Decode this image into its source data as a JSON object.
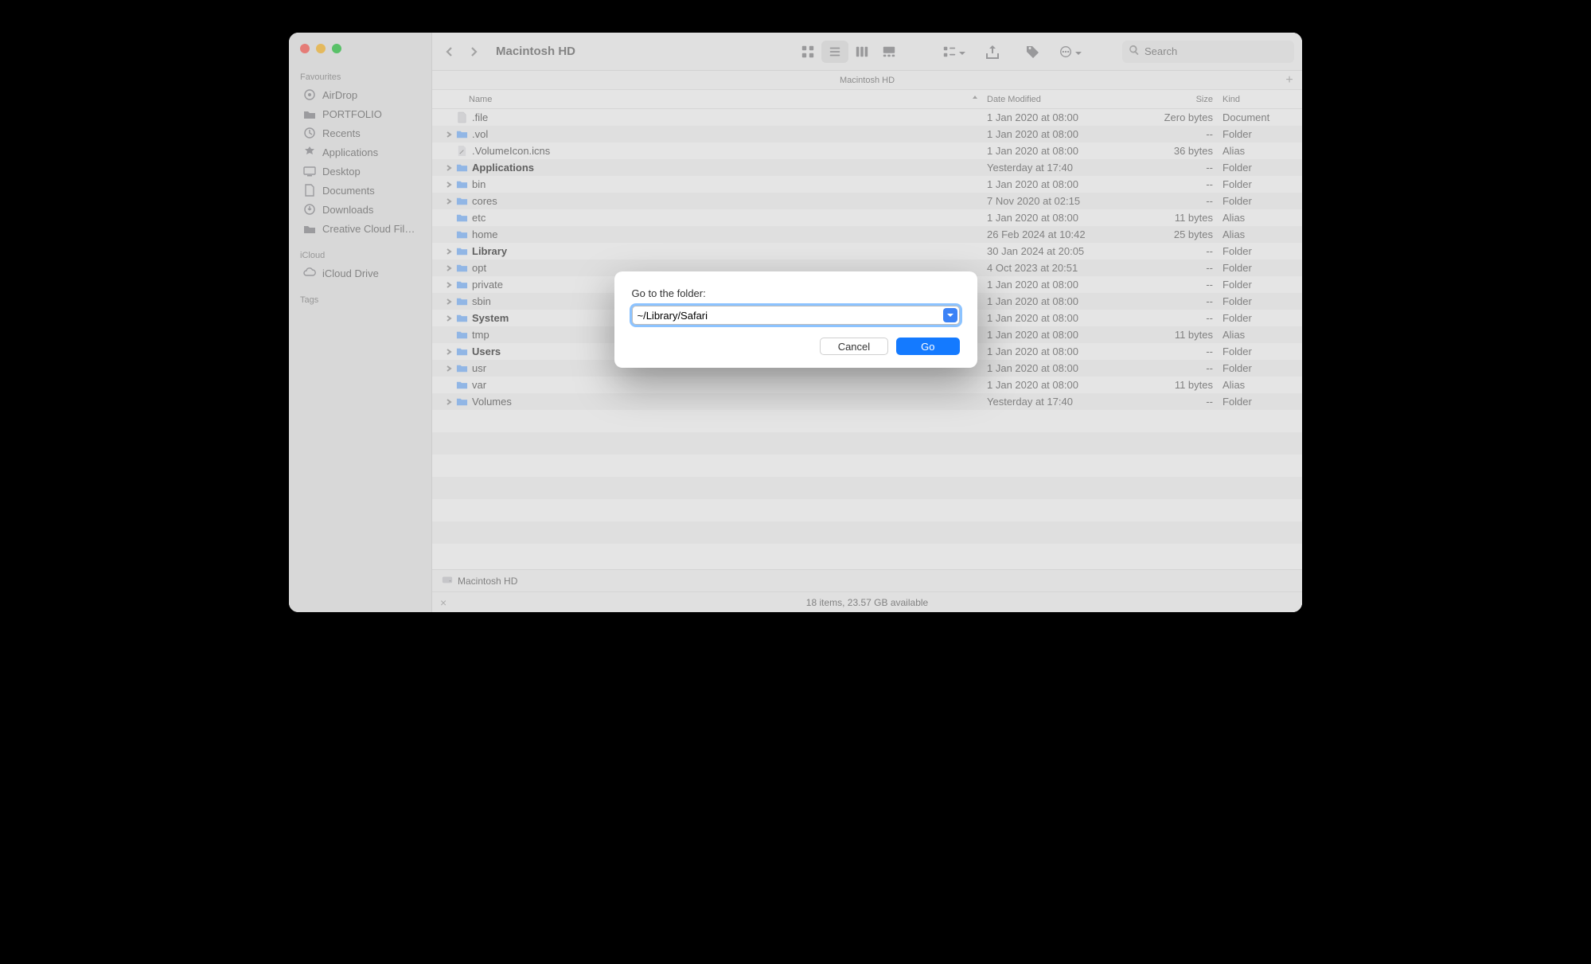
{
  "window_title": "Macintosh HD",
  "subtitle": "Macintosh HD",
  "search_placeholder": "Search",
  "sidebar": {
    "favourites_label": "Favourites",
    "items": [
      {
        "label": "AirDrop"
      },
      {
        "label": "PORTFOLIO"
      },
      {
        "label": "Recents"
      },
      {
        "label": "Applications"
      },
      {
        "label": "Desktop"
      },
      {
        "label": "Documents"
      },
      {
        "label": "Downloads"
      },
      {
        "label": "Creative Cloud Fil…"
      }
    ],
    "icloud_label": "iCloud",
    "icloud_items": [
      {
        "label": "iCloud Drive"
      }
    ],
    "tags_label": "Tags"
  },
  "columns": {
    "name": "Name",
    "date": "Date Modified",
    "size": "Size",
    "kind": "Kind"
  },
  "files": [
    {
      "name": ".file",
      "date": "1 Jan 2020 at 08:00",
      "size": "Zero bytes",
      "kind": "Document",
      "icon": "doc",
      "expand": false,
      "bold": false
    },
    {
      "name": ".vol",
      "date": "1 Jan 2020 at 08:00",
      "size": "--",
      "kind": "Folder",
      "icon": "folder",
      "expand": true,
      "bold": false
    },
    {
      "name": ".VolumeIcon.icns",
      "date": "1 Jan 2020 at 08:00",
      "size": "36 bytes",
      "kind": "Alias",
      "icon": "alias",
      "expand": false,
      "bold": false
    },
    {
      "name": "Applications",
      "date": "Yesterday at 17:40",
      "size": "--",
      "kind": "Folder",
      "icon": "folder",
      "expand": true,
      "bold": true
    },
    {
      "name": "bin",
      "date": "1 Jan 2020 at 08:00",
      "size": "--",
      "kind": "Folder",
      "icon": "folder",
      "expand": true,
      "bold": false
    },
    {
      "name": "cores",
      "date": "7 Nov 2020 at 02:15",
      "size": "--",
      "kind": "Folder",
      "icon": "folder",
      "expand": true,
      "bold": false
    },
    {
      "name": "etc",
      "date": "1 Jan 2020 at 08:00",
      "size": "11 bytes",
      "kind": "Alias",
      "icon": "folder",
      "expand": false,
      "bold": false
    },
    {
      "name": "home",
      "date": "26 Feb 2024 at 10:42",
      "size": "25 bytes",
      "kind": "Alias",
      "icon": "folder",
      "expand": false,
      "bold": false
    },
    {
      "name": "Library",
      "date": "30 Jan 2024 at 20:05",
      "size": "--",
      "kind": "Folder",
      "icon": "folder",
      "expand": true,
      "bold": true
    },
    {
      "name": "opt",
      "date": "4 Oct 2023 at 20:51",
      "size": "--",
      "kind": "Folder",
      "icon": "folder",
      "expand": true,
      "bold": false
    },
    {
      "name": "private",
      "date": "1 Jan 2020 at 08:00",
      "size": "--",
      "kind": "Folder",
      "icon": "folder",
      "expand": true,
      "bold": false
    },
    {
      "name": "sbin",
      "date": "1 Jan 2020 at 08:00",
      "size": "--",
      "kind": "Folder",
      "icon": "folder",
      "expand": true,
      "bold": false
    },
    {
      "name": "System",
      "date": "1 Jan 2020 at 08:00",
      "size": "--",
      "kind": "Folder",
      "icon": "folder",
      "expand": true,
      "bold": true
    },
    {
      "name": "tmp",
      "date": "1 Jan 2020 at 08:00",
      "size": "11 bytes",
      "kind": "Alias",
      "icon": "folder",
      "expand": false,
      "bold": false
    },
    {
      "name": "Users",
      "date": "1 Jan 2020 at 08:00",
      "size": "--",
      "kind": "Folder",
      "icon": "folder",
      "expand": true,
      "bold": true
    },
    {
      "name": "usr",
      "date": "1 Jan 2020 at 08:00",
      "size": "--",
      "kind": "Folder",
      "icon": "folder",
      "expand": true,
      "bold": false
    },
    {
      "name": "var",
      "date": "1 Jan 2020 at 08:00",
      "size": "11 bytes",
      "kind": "Alias",
      "icon": "folder",
      "expand": false,
      "bold": false
    },
    {
      "name": "Volumes",
      "date": "Yesterday at 17:40",
      "size": "--",
      "kind": "Folder",
      "icon": "folder",
      "expand": true,
      "bold": false
    }
  ],
  "pathbar": {
    "label": "Macintosh HD"
  },
  "status": "18 items, 23.57 GB available",
  "sheet": {
    "prompt": "Go to the folder:",
    "value": "~/Library/Safari",
    "cancel": "Cancel",
    "go": "Go"
  }
}
